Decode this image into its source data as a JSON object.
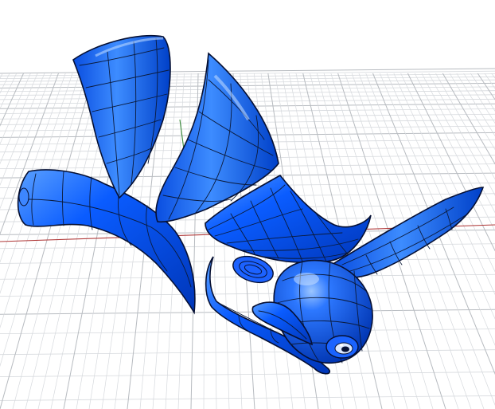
{
  "viewport": {
    "view_type": "perspective",
    "display_mode": "shaded",
    "background_color": "#ffffff",
    "grid": {
      "visible": true,
      "major_line_color": "#b7bbc0",
      "minor_line_color": "#d6d9dd",
      "x_axis_color": "#b03a3a",
      "y_axis_color": "#3a8a3a"
    },
    "surface_color": "#0a5cff",
    "isocurve_color": "#0b1a3a",
    "object": {
      "name": "rhino-logo-model",
      "parts": [
        "horn-left",
        "horn-right",
        "tail-wing",
        "body-shell",
        "head-sphere",
        "snout-horn",
        "eye"
      ]
    }
  }
}
